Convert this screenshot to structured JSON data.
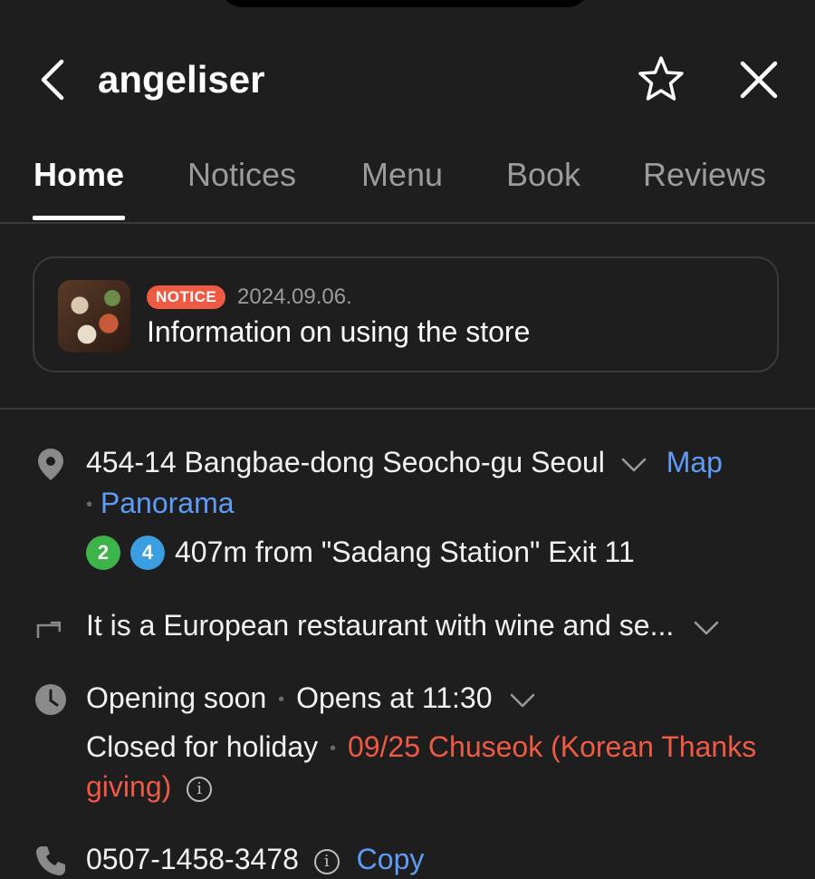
{
  "header": {
    "title": "angeliser"
  },
  "tabs": [
    {
      "label": "Home",
      "active": true
    },
    {
      "label": "Notices",
      "active": false
    },
    {
      "label": "Menu",
      "active": false
    },
    {
      "label": "Book",
      "active": false
    },
    {
      "label": "Reviews",
      "active": false
    }
  ],
  "notice": {
    "badge": "NOTICE",
    "date": "2024.09.06.",
    "title": "Information on using the store"
  },
  "address": {
    "text": "454-14 Bangbae-dong Seocho-gu Seoul",
    "map_link": "Map",
    "separator": "•",
    "panorama_link": "Panorama"
  },
  "subway": {
    "line_a": "2",
    "line_b": "4",
    "line_a_color": "#3cb44a",
    "line_b_color": "#3a9ee0",
    "distance_text": "407m from \"Sadang Station\" Exit 11"
  },
  "description": {
    "text": "It is a European restaurant with wine and se..."
  },
  "hours": {
    "status": "Opening soon",
    "separator": "•",
    "opens": "Opens at 11:30",
    "closed_label": "Closed for holiday",
    "closed_separator": "•",
    "holiday_line1": "09/25 Chuseok (Korean Thanks",
    "holiday_line2": "giving)",
    "info_icon": "i"
  },
  "phone": {
    "number": "0507-1458-3478",
    "info_icon": "i",
    "copy_link": "Copy"
  },
  "colors": {
    "background": "#1e1e1e",
    "accent_link": "#5e9cf7",
    "notice_red": "#ef5a45"
  }
}
